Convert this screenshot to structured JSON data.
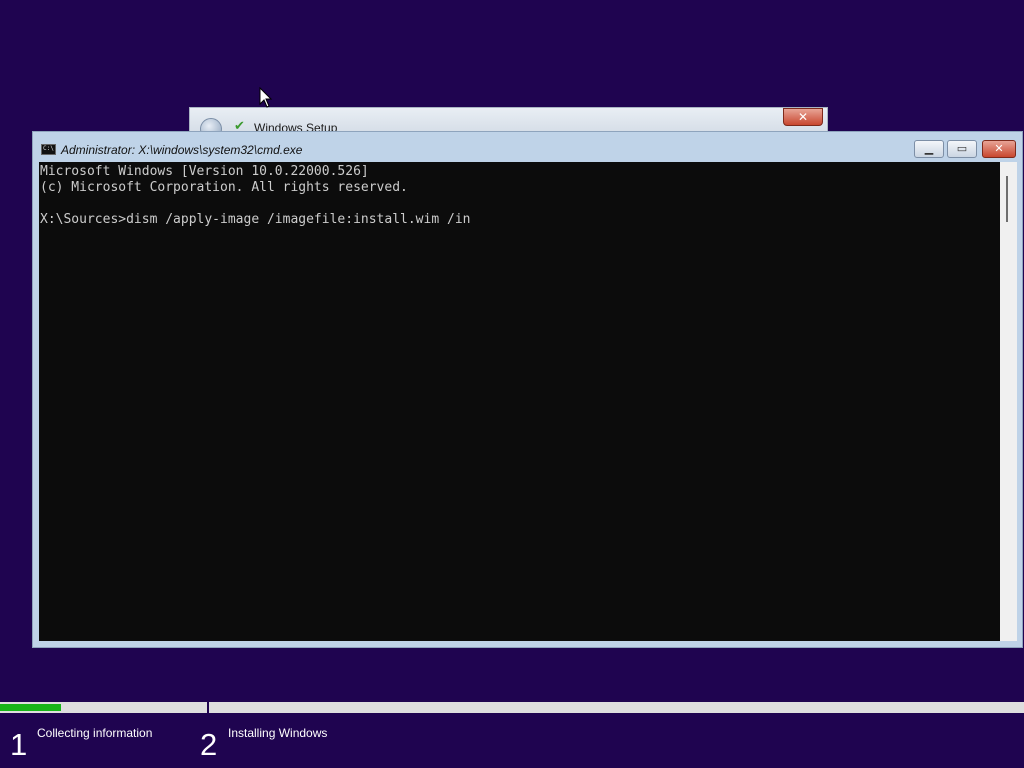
{
  "setup_window": {
    "title": "Windows Setup",
    "close_glyph": "✕"
  },
  "cmd_window": {
    "title": "Administrator: X:\\windows\\system32\\cmd.exe",
    "icon_text": "C:\\",
    "buttons": {
      "minimize_glyph": "▁",
      "maximize_glyph": "▭",
      "close_glyph": "✕"
    },
    "console_lines": [
      "Microsoft Windows [Version 10.0.22000.526]",
      "(c) Microsoft Corporation. All rights reserved.",
      "",
      "X:\\Sources>dism /apply-image /imagefile:install.wim /in"
    ]
  },
  "progress": {
    "fraction": 0.06,
    "steps": [
      {
        "number": "1",
        "label": "Collecting information"
      },
      {
        "number": "2",
        "label": "Installing Windows"
      }
    ]
  },
  "colors": {
    "desktop_background": "#1f0450",
    "progress_fill": "#17b418",
    "console_background": "#0c0c0c",
    "console_text": "#cccccc"
  }
}
